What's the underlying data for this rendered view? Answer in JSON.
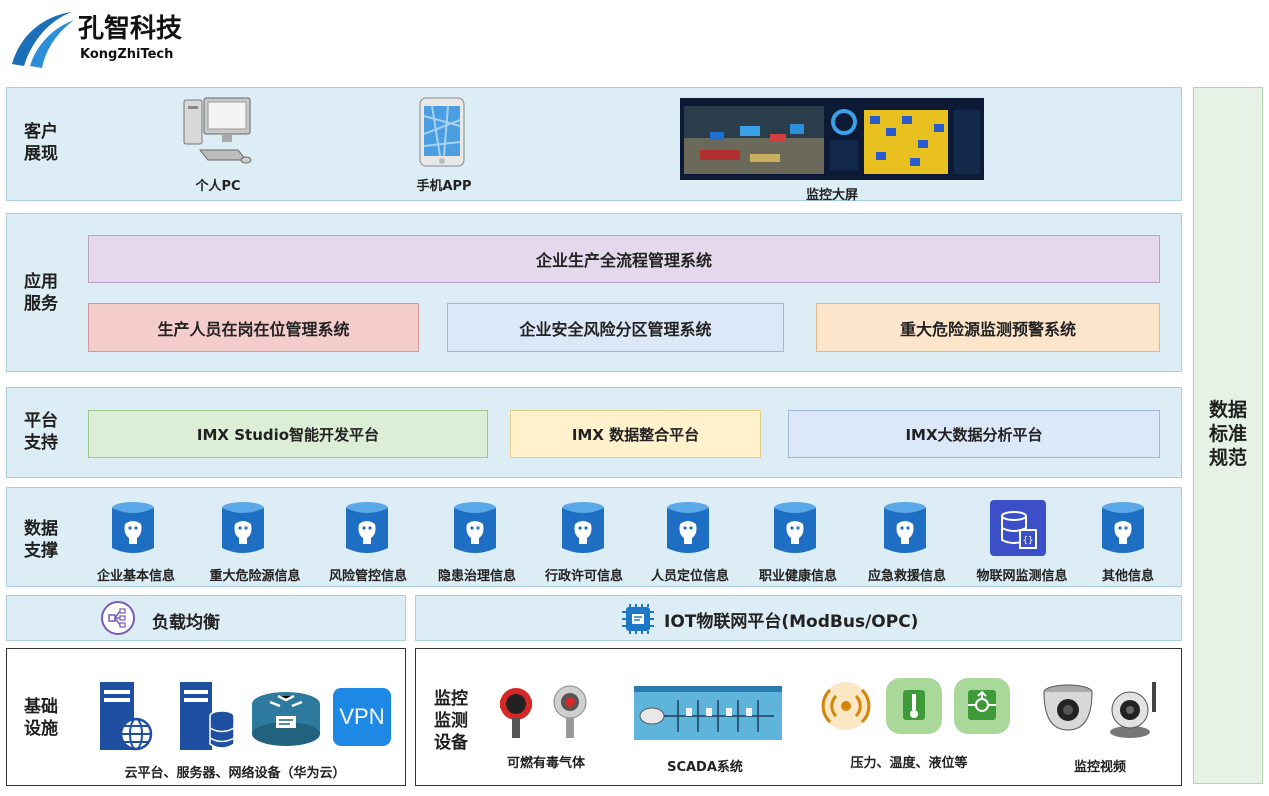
{
  "brand": {
    "name_cn": "孔智科技",
    "name_en": "KongZhiTech"
  },
  "layers": {
    "client": {
      "label": "客户\n展现",
      "items": [
        {
          "label": "个人PC",
          "icon": "desktop-pc-icon"
        },
        {
          "label": "手机APP",
          "icon": "smartphone-icon"
        },
        {
          "label": "监控大屏",
          "icon": "dashboard-screen-icon"
        }
      ]
    },
    "app": {
      "label": "应用\n服务",
      "top": "企业生产全流程管理系统",
      "boxes": [
        "生产人员在岗在位管理系统",
        "企业安全风险分区管理系统",
        "重大危险源监测预警系统"
      ]
    },
    "platform": {
      "label": "平台\n支持",
      "boxes": [
        "IMX Studio智能开发平台",
        "IMX 数据整合平台",
        "IMX大数据分析平台"
      ]
    },
    "data": {
      "label": "数据\n支撑",
      "items": [
        "企业基本信息",
        "重大危险源信息",
        "风险管控信息",
        "隐患治理信息",
        "行政许可信息",
        "人员定位信息",
        "职业健康信息",
        "应急救援信息",
        "物联网监测信息",
        "其他信息"
      ]
    },
    "middle": {
      "lb": "负载均衡",
      "iot": "IOT物联网平台(ModBus/OPC)"
    },
    "infra": {
      "label": "基础\n设施",
      "caption": "云平台、服务器、网络设备（华为云）",
      "vpn": "VPN"
    },
    "monitor": {
      "label": "监控\n监测\n设备",
      "items": [
        "可燃有毒气体",
        "SCADA系统",
        "压力、温度、液位等",
        "监控视频"
      ]
    },
    "side": {
      "label": "数据\n标准\n规范"
    }
  },
  "colors": {
    "layer_bg": "#dcedf5",
    "purple": "#e6d8ec",
    "pink": "#f4cccc",
    "lightblue": "#dce8f8",
    "peach": "#fde5cc",
    "green": "#dcefd6",
    "yellow": "#fff2cc",
    "db_blue": "#1e6fc4",
    "side_green": "#e6f2e6"
  }
}
